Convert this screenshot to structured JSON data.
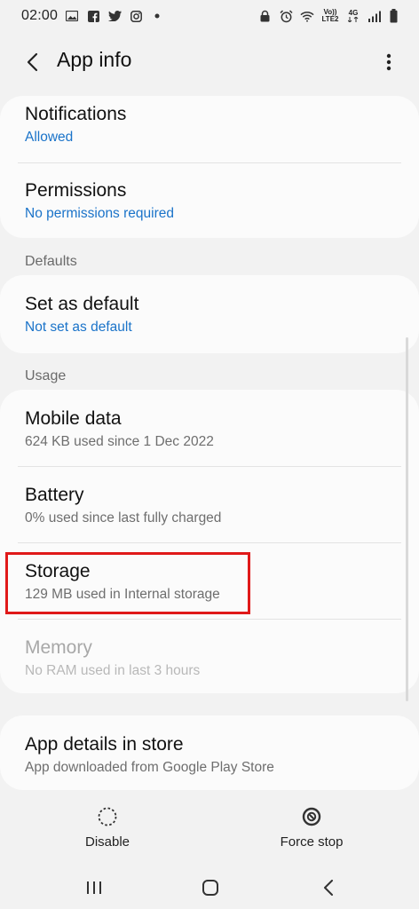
{
  "status_bar": {
    "time": "02:00",
    "left_icons": [
      "image-icon",
      "facebook-icon",
      "twitter-icon",
      "instagram-icon",
      "dot-icon"
    ],
    "right_icons": [
      "lock-icon",
      "alarm-icon",
      "wifi-icon",
      "volte-icon",
      "signal-4g-icon",
      "signal-icon",
      "battery-icon"
    ],
    "volte_label_top": "Vo))",
    "volte_label_bottom": "LTE2",
    "network_label": "4G"
  },
  "app_bar": {
    "title": "App info",
    "back_icon": "chevron-left-icon",
    "more_icon": "more-vert-icon"
  },
  "sections": {
    "defaults_header": "Defaults",
    "usage_header": "Usage"
  },
  "items": {
    "notifications": {
      "title": "Notifications",
      "subtitle": "Allowed"
    },
    "permissions": {
      "title": "Permissions",
      "subtitle": "No permissions required"
    },
    "set_as_default": {
      "title": "Set as default",
      "subtitle": "Not set as default"
    },
    "mobile_data": {
      "title": "Mobile data",
      "subtitle": "624 KB used since 1 Dec 2022"
    },
    "battery": {
      "title": "Battery",
      "subtitle": "0% used since last fully charged"
    },
    "storage": {
      "title": "Storage",
      "subtitle": "129 MB used in Internal storage",
      "highlighted": true
    },
    "memory": {
      "title": "Memory",
      "subtitle": "No RAM used in last 3 hours",
      "disabled": true
    },
    "app_details": {
      "title": "App details in store",
      "subtitle": "App downloaded from Google Play Store"
    }
  },
  "bottom_actions": {
    "disable": {
      "label": "Disable",
      "icon": "disable-icon"
    },
    "force_stop": {
      "label": "Force stop",
      "icon": "force-stop-icon"
    }
  },
  "nav_bar": {
    "recents_icon": "recents-icon",
    "home_icon": "home-icon",
    "back_icon": "back-nav-icon"
  },
  "colors": {
    "background": "#f2f2f2",
    "card": "#fbfbfb",
    "link_blue": "#1a73c9",
    "highlight_red": "#e01919"
  }
}
